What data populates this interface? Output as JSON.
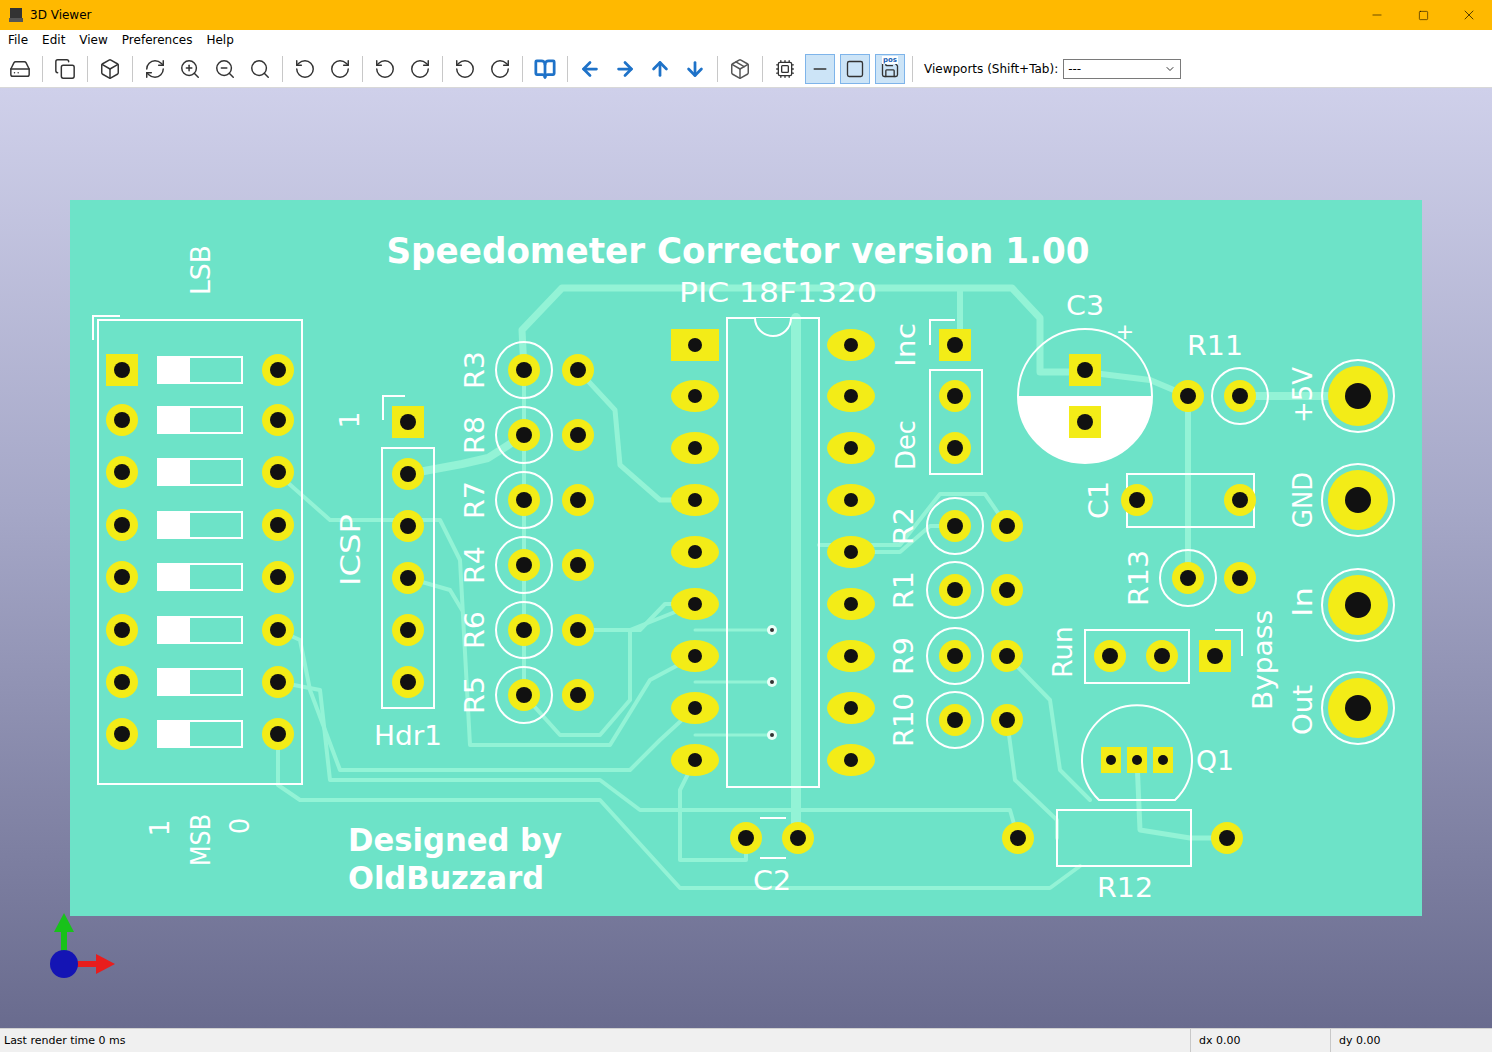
{
  "window": {
    "title": "3D Viewer"
  },
  "menu": [
    "File",
    "Edit",
    "View",
    "Preferences",
    "Help"
  ],
  "toolbar": {
    "viewports_label": "Viewports (Shift+Tab):",
    "viewports_value": "---",
    "toggles": [
      {
        "pressed": false,
        "badge": ""
      },
      {
        "pressed": true,
        "badge": ""
      },
      {
        "pressed": true,
        "badge": ""
      },
      {
        "pressed": true,
        "badge": "pos"
      }
    ]
  },
  "board": {
    "labels": [
      "Speedometer Corrector version 1.00",
      "PIC 18F1320",
      "LSB",
      "1",
      "ICSP",
      "Hdr1",
      "R3",
      "R8",
      "R7",
      "R4",
      "R6",
      "R5",
      "1",
      "MSB",
      "0",
      "Designed by",
      "OldBuzzard",
      "Inc",
      "Dec",
      "R2",
      "R1",
      "R9",
      "R10",
      "C3",
      "+",
      "R11",
      "+5V",
      "GND",
      "In",
      "Out",
      "C1",
      "R13",
      "Run",
      "Bypass",
      "Q1",
      "C2",
      "R12"
    ],
    "dip_switches": [
      {
        "on": true
      },
      {
        "on": true
      },
      {
        "on": true
      },
      {
        "on": true
      },
      {
        "on": true
      },
      {
        "on": true
      },
      {
        "on": true
      },
      {
        "on": true
      }
    ]
  },
  "status_bar": {
    "render_time": "Last render time 0 ms",
    "dx": "dx 0.00",
    "dy": "dy 0.00"
  }
}
